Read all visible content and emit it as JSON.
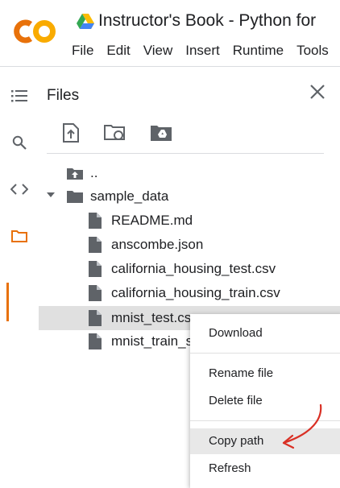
{
  "app": {
    "title": "Instructor's Book - Python for",
    "menu": [
      "File",
      "Edit",
      "View",
      "Insert",
      "Runtime",
      "Tools"
    ],
    "logo_icon": "colab-logo",
    "drive_icon": "google-drive-icon",
    "brand_color": "#f9ab00",
    "brand_color_dark": "#e8710a"
  },
  "rail": {
    "items": [
      {
        "name": "table-of-contents-icon"
      },
      {
        "name": "search-icon"
      },
      {
        "name": "code-snippets-icon"
      },
      {
        "name": "files-folder-icon",
        "active": true
      }
    ]
  },
  "files_panel": {
    "title": "Files",
    "toolbar": [
      "upload-file-icon",
      "refresh-folder-icon",
      "mount-drive-icon"
    ],
    "tree": [
      {
        "label": "..",
        "type": "parent"
      },
      {
        "label": "sample_data",
        "type": "folder",
        "expanded": true
      },
      {
        "label": "README.md",
        "type": "file"
      },
      {
        "label": "anscombe.json",
        "type": "file"
      },
      {
        "label": "california_housing_test.csv",
        "type": "file"
      },
      {
        "label": "california_housing_train.csv",
        "type": "file"
      },
      {
        "label": "mnist_test.csv",
        "type": "file",
        "selected": true
      },
      {
        "label": "mnist_train_small.csv",
        "type": "file"
      }
    ]
  },
  "context_menu": {
    "items": [
      {
        "label": "Download"
      },
      {
        "label": "Rename file"
      },
      {
        "label": "Delete file"
      },
      {
        "label": "Copy path",
        "highlighted": true
      },
      {
        "label": "Refresh"
      }
    ]
  },
  "annotation": {
    "color": "#d93025"
  }
}
